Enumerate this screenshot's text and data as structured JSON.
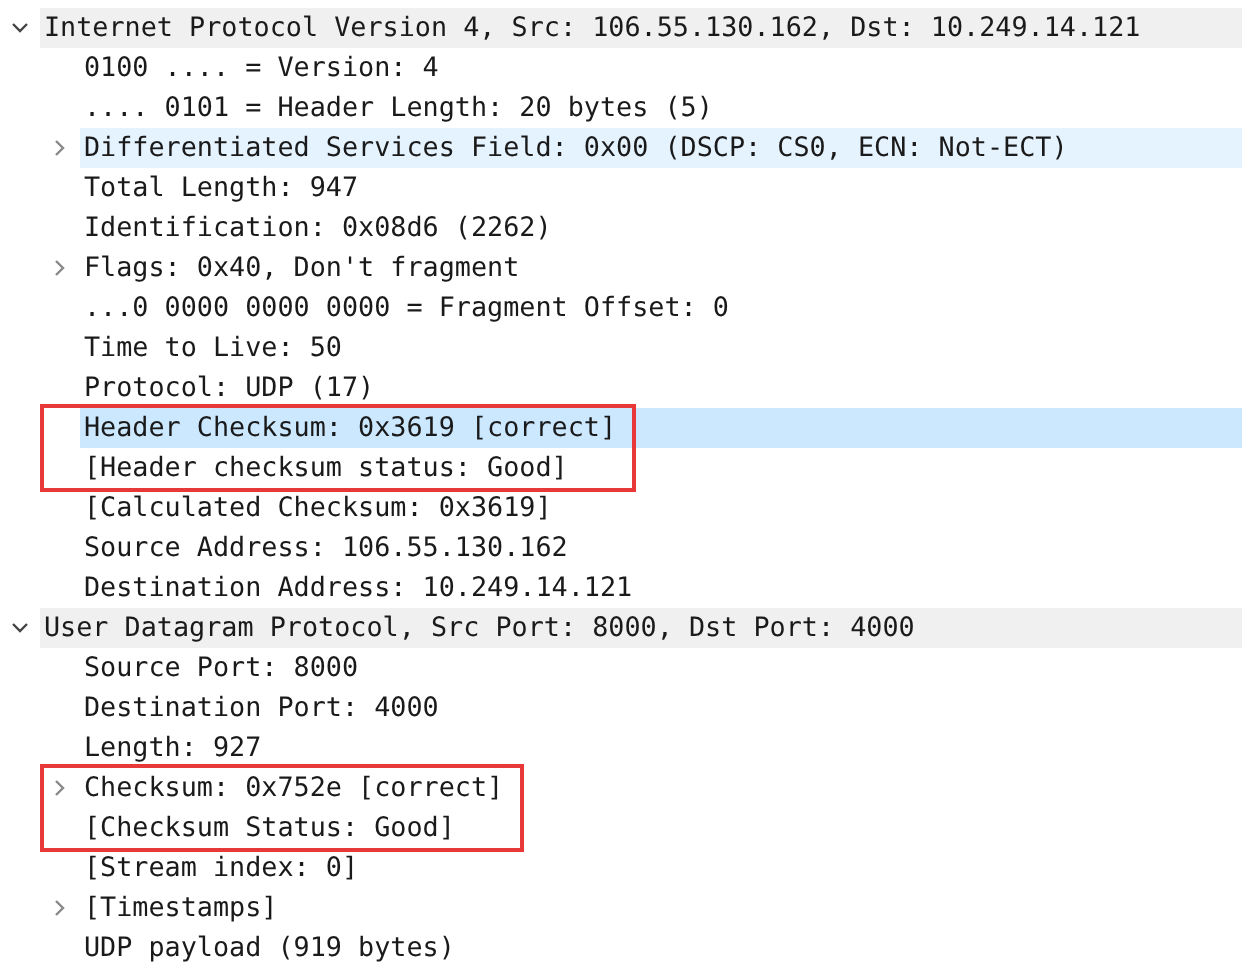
{
  "tree": [
    {
      "label": "Internet Protocol Version 4, Src: 106.55.130.162, Dst: 10.249.14.121",
      "selected": false,
      "hovered": false,
      "boxed": false,
      "expanded": true,
      "children": [
        {
          "label": "0100 .... = Version: 4",
          "selected": false,
          "hovered": false,
          "boxed": false
        },
        {
          "label": ".... 0101 = Header Length: 20 bytes (5)",
          "selected": false,
          "hovered": false,
          "boxed": false
        },
        {
          "label": "Differentiated Services Field: 0x00 (DSCP: CS0, ECN: Not-ECT)",
          "selected": false,
          "hovered": true,
          "boxed": false,
          "expanded": false
        },
        {
          "label": "Total Length: 947",
          "selected": false,
          "hovered": false,
          "boxed": false
        },
        {
          "label": "Identification: 0x08d6 (2262)",
          "selected": false,
          "hovered": false,
          "boxed": false
        },
        {
          "label": "Flags: 0x40, Don't fragment",
          "selected": false,
          "hovered": false,
          "boxed": false,
          "expanded": false
        },
        {
          "label": "...0 0000 0000 0000 = Fragment Offset: 0",
          "selected": false,
          "hovered": false,
          "boxed": false
        },
        {
          "label": "Time to Live: 50",
          "selected": false,
          "hovered": false,
          "boxed": false
        },
        {
          "label": "Protocol: UDP (17)",
          "selected": false,
          "hovered": false,
          "boxed": false
        },
        {
          "label": "Header Checksum: 0x3619 [correct]",
          "selected": true,
          "hovered": false,
          "boxed": true
        },
        {
          "label": "[Header checksum status: Good]",
          "selected": false,
          "hovered": false,
          "boxed": true
        },
        {
          "label": "[Calculated Checksum: 0x3619]",
          "selected": false,
          "hovered": false,
          "boxed": false
        },
        {
          "label": "Source Address: 106.55.130.162",
          "selected": false,
          "hovered": false,
          "boxed": false
        },
        {
          "label": "Destination Address: 10.249.14.121",
          "selected": false,
          "hovered": false,
          "boxed": false
        }
      ]
    },
    {
      "label": "User Datagram Protocol, Src Port: 8000, Dst Port: 4000",
      "selected": false,
      "hovered": false,
      "boxed": false,
      "expanded": true,
      "children": [
        {
          "label": "Source Port: 8000",
          "selected": false,
          "hovered": false,
          "boxed": false
        },
        {
          "label": "Destination Port: 4000",
          "selected": false,
          "hovered": false,
          "boxed": false
        },
        {
          "label": "Length: 927",
          "selected": false,
          "hovered": false,
          "boxed": false
        },
        {
          "label": "Checksum: 0x752e [correct]",
          "selected": false,
          "hovered": false,
          "boxed": true,
          "expanded": false
        },
        {
          "label": "[Checksum Status: Good]",
          "selected": false,
          "hovered": false,
          "boxed": true
        },
        {
          "label": "[Stream index: 0]",
          "selected": false,
          "hovered": false,
          "boxed": false
        },
        {
          "label": "[Timestamps]",
          "selected": false,
          "hovered": false,
          "boxed": false,
          "expanded": false
        },
        {
          "label": "UDP payload (919 bytes)",
          "selected": false,
          "hovered": false,
          "boxed": false
        }
      ]
    }
  ]
}
